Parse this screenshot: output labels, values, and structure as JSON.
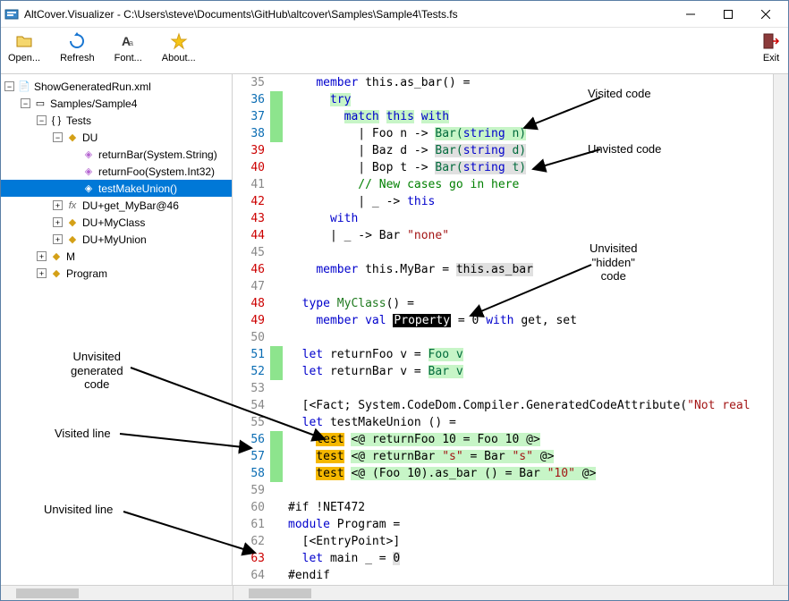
{
  "window": {
    "title": "AltCover.Visualizer - C:\\Users\\steve\\Documents\\GitHub\\altcover\\Samples\\Sample4\\Tests.fs"
  },
  "toolbar": {
    "open": "Open...",
    "refresh": "Refresh",
    "font": "Font...",
    "about": "About...",
    "exit": "Exit"
  },
  "tree": {
    "root": "ShowGeneratedRun.xml",
    "assembly": "Samples/Sample4",
    "namespace": "Tests",
    "du": "DU",
    "m_returnBar": "returnBar(System.String)",
    "m_returnFoo": "returnFoo(System.Int32)",
    "m_testMakeUnion": "testMakeUnion()",
    "m_get_MyBar": "DU+get_MyBar@46",
    "m_MyClass": "DU+MyClass",
    "m_MyUnion": "DU+MyUnion",
    "m_M": "M",
    "m_Program": "Program"
  },
  "code": {
    "lines": [
      {
        "n": 35,
        "cls": "ln-gray",
        "cov": "",
        "html": "    <span class='kw'>member</span> this.as_bar() ="
      },
      {
        "n": 36,
        "cls": "ln-blue",
        "cov": "v",
        "html": "      <span class='kw hl-visit'>try</span>"
      },
      {
        "n": 37,
        "cls": "ln-blue",
        "cov": "v",
        "html": "        <span class='kw hl-visit'>match</span> <span class='kw hl-visit'>this</span> <span class='kw hl-visit'>with</span>"
      },
      {
        "n": 38,
        "cls": "ln-blue",
        "cov": "v",
        "html": "          | Foo n -&gt; <span class='fn hl-visit'>Bar(<span class='kw'>string</span> n)</span>"
      },
      {
        "n": 39,
        "cls": "ln-red",
        "cov": "",
        "html": "          | Baz d -&gt; <span class='fn hl-unvisit'>Bar(<span class='kw'>string</span> d)</span>"
      },
      {
        "n": 40,
        "cls": "ln-red",
        "cov": "",
        "html": "          | Bop t -&gt; <span class='fn hl-unvisit'>Bar(<span class='kw'>string</span> t)</span>"
      },
      {
        "n": 41,
        "cls": "ln-gray",
        "cov": "",
        "html": "          <span class='com'>// New cases go in here</span>"
      },
      {
        "n": 42,
        "cls": "ln-red",
        "cov": "",
        "html": "          | _ -&gt; <span class='kw'>this</span>"
      },
      {
        "n": 43,
        "cls": "ln-red",
        "cov": "",
        "html": "      <span class='kw'>with</span>"
      },
      {
        "n": 44,
        "cls": "ln-red",
        "cov": "",
        "html": "      | _ -&gt; Bar <span class='str'>\"none\"</span>"
      },
      {
        "n": 45,
        "cls": "ln-gray",
        "cov": "",
        "html": ""
      },
      {
        "n": 46,
        "cls": "ln-red",
        "cov": "",
        "html": "    <span class='kw'>member</span> this.MyBar = <span class='hl-unvisit'>this.as_bar</span>"
      },
      {
        "n": 47,
        "cls": "ln-gray",
        "cov": "",
        "html": ""
      },
      {
        "n": 48,
        "cls": "ln-red",
        "cov": "",
        "html": "  <span class='kw'>type</span> <span class='ty'>MyClass</span>() ="
      },
      {
        "n": 49,
        "cls": "ln-red",
        "cov": "",
        "html": "    <span class='kw'>member val</span> <span class='hl-prop'>Property</span> = 0 <span class='kw'>with</span> get, set"
      },
      {
        "n": 50,
        "cls": "ln-gray",
        "cov": "",
        "html": ""
      },
      {
        "n": 51,
        "cls": "ln-blue",
        "cov": "v",
        "html": "  <span class='kw'>let</span> returnFoo v = <span class='fn hl-visit'>Foo v</span>"
      },
      {
        "n": 52,
        "cls": "ln-blue",
        "cov": "v",
        "html": "  <span class='kw'>let</span> returnBar v = <span class='fn hl-visit'>Bar v</span>"
      },
      {
        "n": 53,
        "cls": "ln-gray",
        "cov": "",
        "html": ""
      },
      {
        "n": 54,
        "cls": "ln-gray",
        "cov": "",
        "html": "  [&lt;Fact; System.CodeDom.Compiler.GeneratedCodeAttribute(<span class='str'>\"Not real</span>"
      },
      {
        "n": 55,
        "cls": "ln-gray",
        "cov": "",
        "html": "  <span class='kw'>let</span> testMakeUnion () ="
      },
      {
        "n": 56,
        "cls": "ln-blue",
        "cov": "v",
        "html": "    <span class='hl-test'>test</span> <span class='hl-visit'>&lt;@ returnFoo 10 = Foo 10 @&gt;</span>"
      },
      {
        "n": 57,
        "cls": "ln-blue",
        "cov": "v",
        "html": "    <span class='hl-test'>test</span> <span class='hl-visit'>&lt;@ returnBar <span class='str'>\"s\"</span> = Bar <span class='str'>\"s\"</span> @&gt;</span>"
      },
      {
        "n": 58,
        "cls": "ln-blue",
        "cov": "v",
        "html": "    <span class='hl-test'>test</span> <span class='hl-visit'>&lt;@ (Foo 10).as_bar () = Bar <span class='str'>\"10\"</span> @&gt;</span>"
      },
      {
        "n": 59,
        "cls": "ln-gray",
        "cov": "",
        "html": ""
      },
      {
        "n": 60,
        "cls": "ln-gray",
        "cov": "",
        "html": "#if !NET472"
      },
      {
        "n": 61,
        "cls": "ln-gray",
        "cov": "",
        "html": "<span class='kw'>module</span> Program ="
      },
      {
        "n": 62,
        "cls": "ln-gray",
        "cov": "",
        "html": "  [&lt;EntryPoint&gt;]"
      },
      {
        "n": 63,
        "cls": "ln-red",
        "cov": "",
        "html": "  <span class='kw'>let</span> main _ = <span class='hl-unvisit'>0</span>"
      },
      {
        "n": 64,
        "cls": "ln-gray",
        "cov": "",
        "html": "#endif"
      }
    ]
  },
  "annotations": {
    "visited_code": "Visited code",
    "unvisited_code": "Unvisted code",
    "unvisited_hidden": "Unvisited\n\"hidden\"\ncode",
    "unvisited_generated": "Unvisited\ngenerated\ncode",
    "visited_line": "Visited line",
    "unvisited_line": "Unvisited line"
  }
}
